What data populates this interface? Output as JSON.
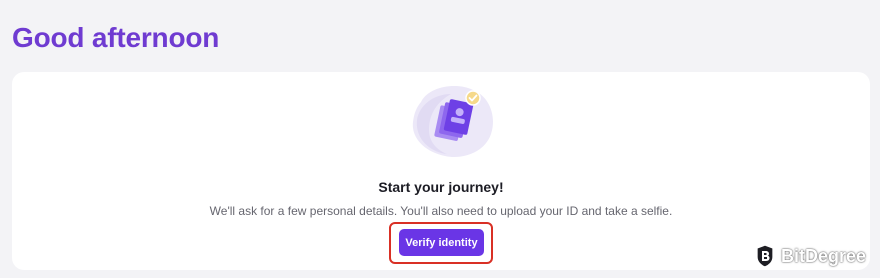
{
  "header": {
    "greeting": "Good afternoon"
  },
  "onboarding_card": {
    "illustration_icon": "id-documents-verified-illustration",
    "title": "Start your journey!",
    "description": "We'll ask for a few personal details. You'll also need to upload your ID and take a selfie.",
    "cta_label": "Verify identity"
  },
  "watermark": {
    "brand_name": "BitDegree",
    "logo_icon": "bitdegree-shield-logo"
  },
  "colors": {
    "greeting_text": "#6f3bd1",
    "cta_background": "#6a35e6",
    "highlight_border": "#d93025",
    "page_background": "#f3f3f6"
  }
}
